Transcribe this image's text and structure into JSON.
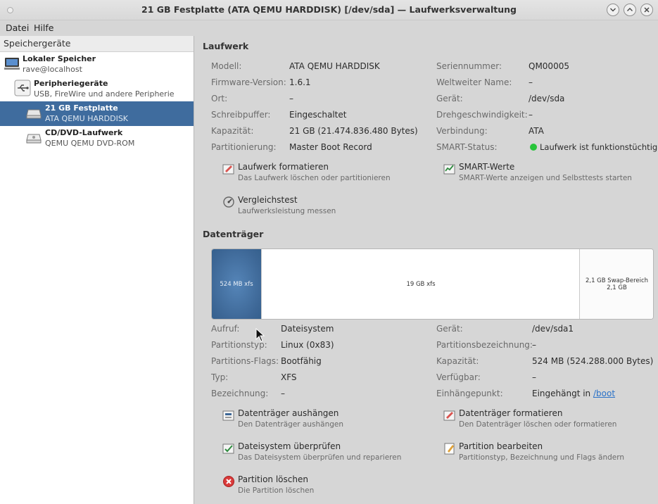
{
  "window": {
    "title": "21 GB Festplatte (ATA QEMU HARDDISK) [/dev/sda] — Laufwerksverwaltung",
    "buttons": [
      "chevron-down",
      "chevron-up",
      "close"
    ]
  },
  "menubar": {
    "items": [
      "Datei",
      "Hilfe"
    ]
  },
  "sidebar": {
    "header": "Speichergeräte",
    "items": [
      {
        "name": "Lokaler Speicher",
        "sub": "rave@localhost",
        "icon": "computer-icon"
      },
      {
        "name": "Peripheriegeräte",
        "sub": "USB, FireWire und andere Peripherie",
        "icon": "usb-icon"
      },
      {
        "name": "21 GB Festplatte",
        "sub": "ATA QEMU HARDDISK",
        "icon": "harddisk-icon",
        "selected": true
      },
      {
        "name": "CD/DVD-Laufwerk",
        "sub": "QEMU QEMU DVD-ROM",
        "icon": "optical-drive-icon"
      }
    ]
  },
  "drive": {
    "section_title": "Laufwerk",
    "left": [
      {
        "label": "Modell:",
        "value": "ATA QEMU HARDDISK"
      },
      {
        "label": "Firmware-Version:",
        "value": "1.6.1"
      },
      {
        "label": "Ort:",
        "value": "–"
      },
      {
        "label": "Schreibpuffer:",
        "value": "Eingeschaltet"
      },
      {
        "label": "Kapazität:",
        "value": "21 GB (21.474.836.480 Bytes)"
      },
      {
        "label": "Partitionierung:",
        "value": "Master Boot Record"
      }
    ],
    "right": [
      {
        "label": "Seriennummer:",
        "value": "QM00005"
      },
      {
        "label": "Weltweiter Name:",
        "value": "–"
      },
      {
        "label": "Gerät:",
        "value": "/dev/sda"
      },
      {
        "label": "Drehgeschwindigkeit:",
        "value": "–"
      },
      {
        "label": "Verbindung:",
        "value": "ATA"
      },
      {
        "label": "SMART-Status:",
        "value": "Laufwerk ist funktionstüchtig"
      }
    ],
    "smart_color": "#27c43a",
    "actions": [
      {
        "title": "Laufwerk formatieren",
        "desc": "Das Laufwerk löschen oder partitionieren",
        "icon": "format-drive-icon"
      },
      {
        "title": "SMART-Werte",
        "desc": "SMART-Werte anzeigen und Selbsttests starten",
        "icon": "smart-values-icon"
      },
      {
        "title": "Vergleichstest",
        "desc": "Laufwerksleistung messen",
        "icon": "benchmark-icon"
      }
    ]
  },
  "volumes": {
    "section_title": "Datenträger",
    "segments": [
      {
        "label": "524 MB xfs",
        "selected": true
      },
      {
        "label": "19 GB xfs"
      },
      {
        "label": "2,1 GB Swap-Bereich",
        "label2": "2,1 GB"
      }
    ],
    "left": [
      {
        "label": "Aufruf:",
        "value": "Dateisystem"
      },
      {
        "label": "Partitionstyp:",
        "value": "Linux (0x83)"
      },
      {
        "label": "Partitions-Flags:",
        "value": "Bootfähig"
      },
      {
        "label": "Typ:",
        "value": "XFS"
      },
      {
        "label": "Bezeichnung:",
        "value": "–"
      }
    ],
    "right": [
      {
        "label": "Gerät:",
        "value": "/dev/sda1"
      },
      {
        "label": "Partitionsbezeichnung:",
        "value": "–"
      },
      {
        "label": "Kapazität:",
        "value": "524 MB (524.288.000 Bytes)"
      },
      {
        "label": "Verfügbar:",
        "value": "–"
      },
      {
        "label": "Einhängepunkt:",
        "value_prefix": "Eingehängt in ",
        "link": "/boot"
      }
    ],
    "selected_color": "#3f6c9e",
    "actions": [
      {
        "title": "Datenträger aushängen",
        "desc": "Den Datenträger aushängen",
        "icon": "unmount-icon"
      },
      {
        "title": "Datenträger formatieren",
        "desc": "Den Datenträger löschen oder formatieren",
        "icon": "format-volume-icon"
      },
      {
        "title": "Dateisystem überprüfen",
        "desc": "Das Dateisystem überprüfen und reparieren",
        "icon": "check-filesystem-icon"
      },
      {
        "title": "Partition bearbeiten",
        "desc": "Partitionstyp, Bezeichnung und Flags ändern",
        "icon": "edit-partition-icon"
      },
      {
        "title": "Partition löschen",
        "desc": "Die Partition löschen",
        "icon": "delete-partition-icon"
      }
    ]
  }
}
